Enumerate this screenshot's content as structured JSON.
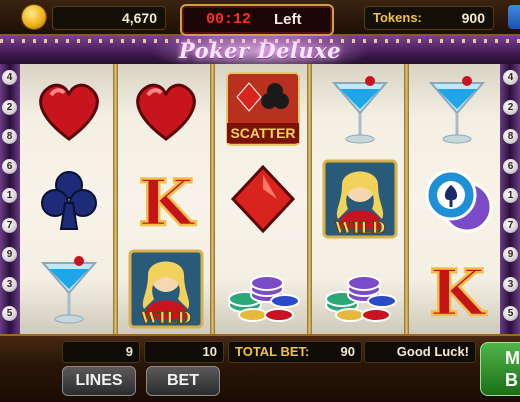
{
  "header": {
    "balance": "4,670",
    "timer": "00:12",
    "timer_label": "Left",
    "tokens_label": "Tokens:",
    "tokens": "900"
  },
  "game": {
    "logo": "Poker Deluxe",
    "left_lines": [
      "4",
      "2",
      "8",
      "6",
      "1",
      "7",
      "9",
      "3",
      "5"
    ],
    "right_lines": [
      "4",
      "2",
      "8",
      "6",
      "1",
      "7",
      "9",
      "3",
      "5"
    ],
    "reels": [
      [
        "heart",
        "club",
        "martini"
      ],
      [
        "heart",
        "king",
        "wild"
      ],
      [
        "scatter",
        "diamond",
        "chips"
      ],
      [
        "martini",
        "wild",
        "chips"
      ],
      [
        "martini",
        "poker-chips",
        "king"
      ]
    ],
    "symbol_text": {
      "scatter": "SCATTER",
      "wild": "WILD",
      "king": "K"
    }
  },
  "bottom": {
    "lines_value": "9",
    "bet_value": "10",
    "total_bet_label": "TOTAL BET:",
    "total_bet": "90",
    "message": "Good Luck!",
    "lines_button": "LINES",
    "bet_button": "BET",
    "max_button": "M\nB"
  },
  "colors": {
    "accent_gold": "#f0c247",
    "timer_red": "#ff2a2a",
    "heart_red": "#c8141c",
    "club_blue": "#1c2c78",
    "max_green": "#2f8f28"
  }
}
